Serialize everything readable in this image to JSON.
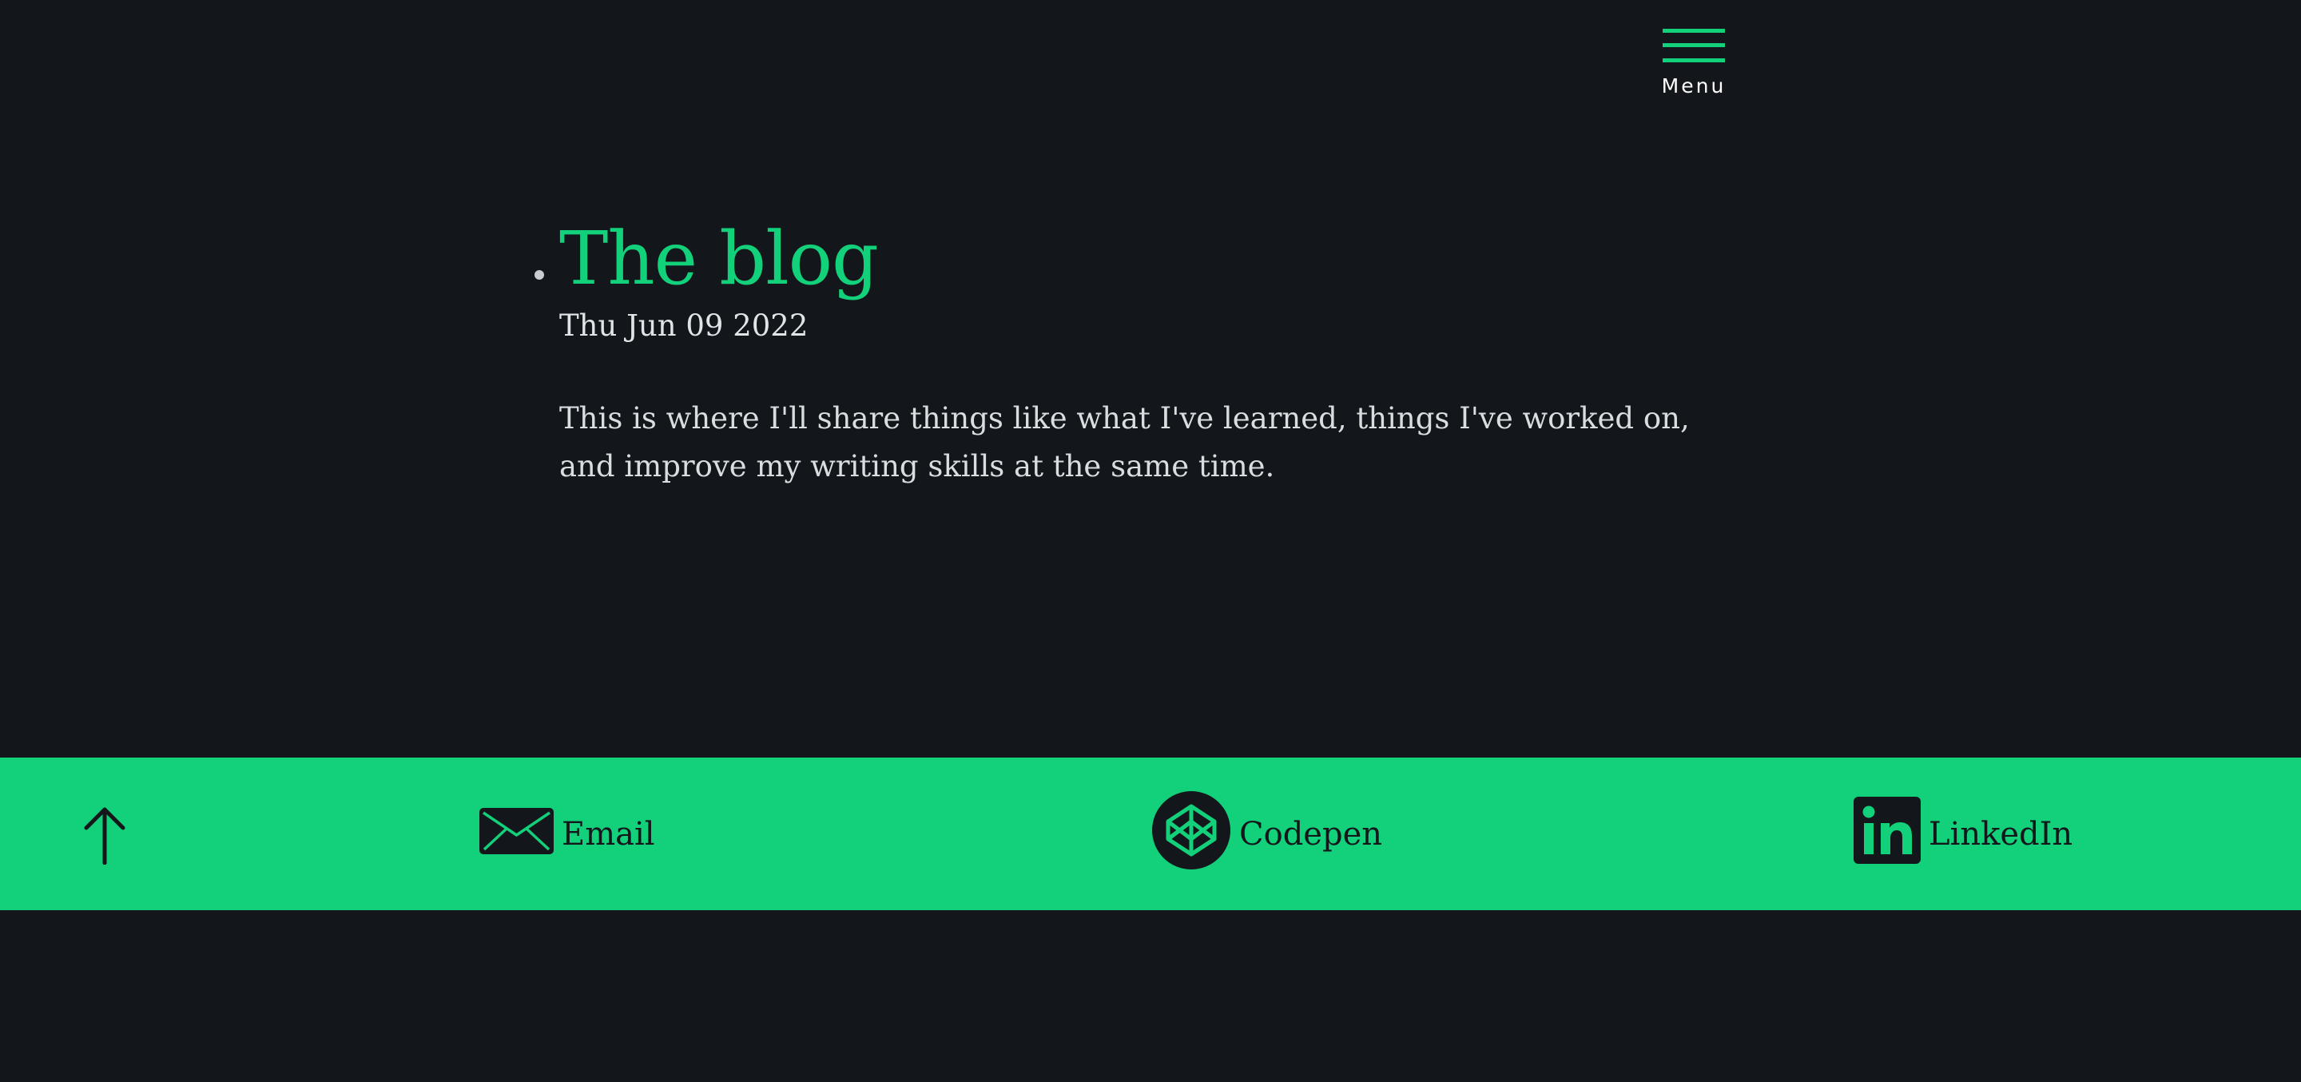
{
  "nav": {
    "menu_label": "Menu"
  },
  "post": {
    "title": "The blog",
    "date": "Thu Jun 09 2022",
    "body": "This is where I'll share things like what I've learned, things I've worked on, and improve my writing skills at the same time."
  },
  "footer": {
    "back_to_top_icon": "arrow-up-icon",
    "links": [
      {
        "label": "Email",
        "icon": "envelope-icon"
      },
      {
        "label": "Codepen",
        "icon": "codepen-icon"
      },
      {
        "label": "LinkedIn",
        "icon": "linkedin-icon"
      }
    ]
  },
  "colors": {
    "background": "#13171b",
    "accent": "#13d07a",
    "text": "#d9dde0"
  }
}
